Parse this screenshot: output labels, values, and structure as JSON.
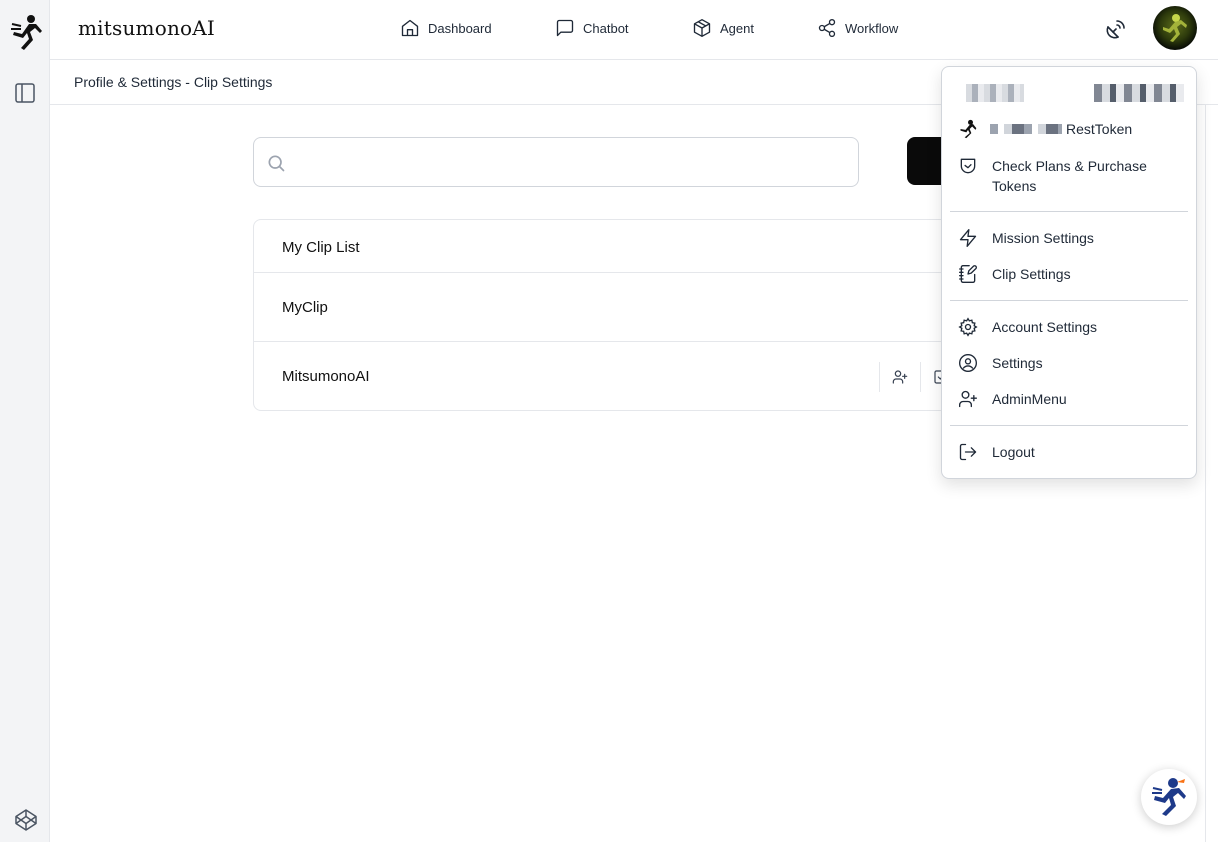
{
  "app": {
    "brand": "mitsumonoAI"
  },
  "nav": {
    "dashboard": "Dashboard",
    "chatbot": "Chatbot",
    "agent": "Agent",
    "workflow": "Workflow"
  },
  "breadcrumb": "Profile & Settings - Clip Settings",
  "search": {
    "value": "",
    "placeholder": ""
  },
  "clips": {
    "header": "My Clip List",
    "rows": [
      {
        "name": "MyClip"
      },
      {
        "name": "MitsumonoAI"
      }
    ]
  },
  "user_menu": {
    "token_label": "RestToken",
    "plans": "Check Plans & Purchase Tokens",
    "mission_settings": "Mission Settings",
    "clip_settings": "Clip Settings",
    "account_settings": "Account Settings",
    "settings": "Settings",
    "admin_menu": "AdminMenu",
    "logout": "Logout"
  },
  "colors": {
    "accent_dark": "#0a0a0a",
    "rail_bg": "#f3f4f6",
    "helper_runner": "#1e3a8a",
    "helper_accent": "#f97316"
  },
  "icons": {
    "rail": [
      "runner-logo-icon",
      "panel-toggle-icon",
      "codepen-icon"
    ],
    "nav": [
      "home-icon",
      "message-square-icon",
      "package-icon",
      "share-nodes-icon"
    ],
    "header": [
      "satellite-dish-icon",
      "user-avatar"
    ],
    "menu": [
      "runner-icon",
      "shield-check-icon",
      "zap-icon",
      "notebook-pen-icon",
      "gear-icon",
      "user-circle-icon",
      "user-plus-icon",
      "log-out-icon"
    ]
  }
}
